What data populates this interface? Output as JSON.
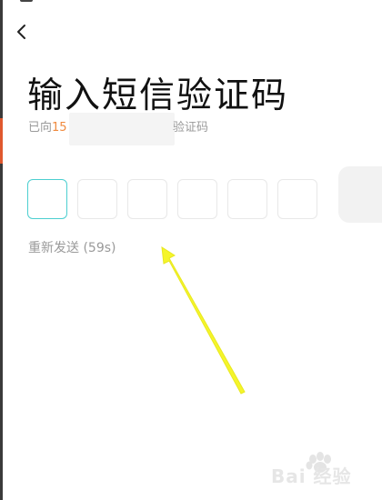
{
  "header": {
    "back_icon": "chevron-left-icon"
  },
  "title": "输入短信验证码",
  "subtitle": {
    "prefix": "已向",
    "phone_prefix": "15",
    "suffix": "验证码"
  },
  "code_input": {
    "length": 6,
    "active_index": 0,
    "accent_color": "#4ccfd0"
  },
  "resend": {
    "label": "重新发送 (59s)"
  },
  "watermark": {
    "text": "Bai 经验"
  },
  "colors": {
    "phone_highlight": "#f08a3e",
    "annotation_arrow": "#f5f52a"
  }
}
